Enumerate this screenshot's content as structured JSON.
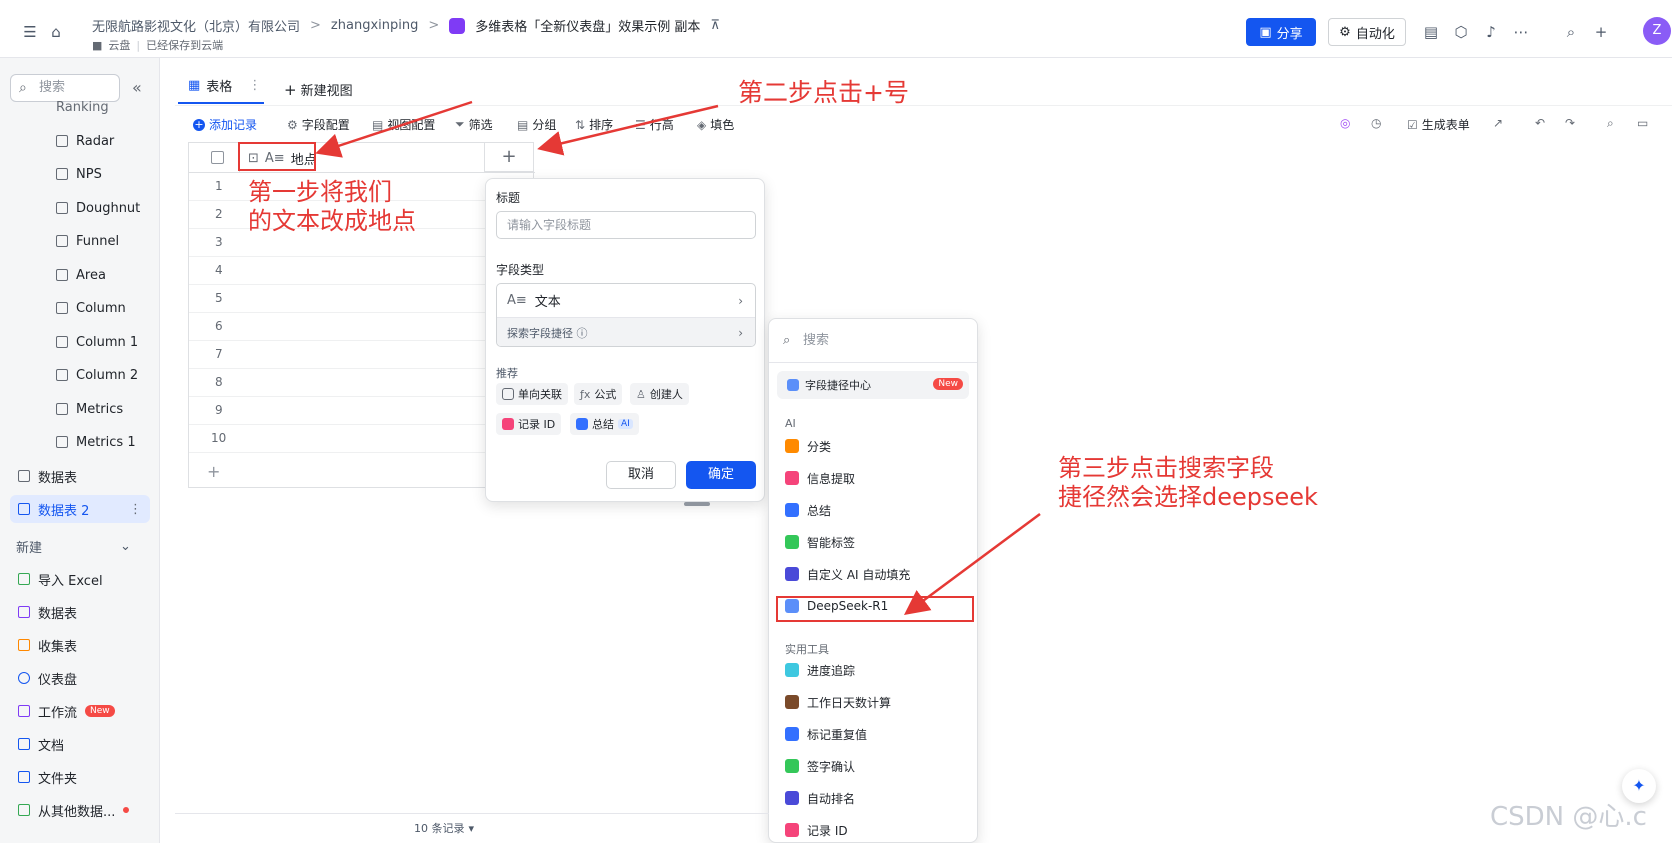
{
  "header": {
    "breadcrumb": [
      "无限航路影视文化（北京）有限公司",
      "zhangxinping"
    ],
    "doc_title": "多维表格「全新仪表盘」效果示例 副本",
    "pin_icon": "pin-icon",
    "location": "云盘",
    "save_status": "已经保存到云端",
    "share_label": "分享",
    "automation_label": "自动化",
    "avatar_letter": "Z"
  },
  "sidebar": {
    "search_placeholder": "搜索",
    "partial_item": "Ranking",
    "dashboards": [
      "Radar",
      "NPS",
      "Doughnut",
      "Funnel",
      "Area",
      "Column",
      "Column 1",
      "Column 2",
      "Metrics",
      "Metrics 1"
    ],
    "tables": [
      "数据表",
      "数据表 2"
    ],
    "new_label": "新建",
    "new_items": [
      "导入 Excel",
      "数据表",
      "收集表",
      "仪表盘",
      "工作流",
      "文档",
      "文件夹",
      "从其他数据..."
    ],
    "new_badge": "New"
  },
  "view": {
    "tab_label": "表格",
    "new_view_label": "新建视图"
  },
  "toolbar": {
    "add_record": "添加记录",
    "field_config": "字段配置",
    "view_config": "视图配置",
    "filter": "筛选",
    "group": "分组",
    "sort": "排序",
    "row_height": "行高",
    "fill_color": "填色",
    "generate_form": "生成表单"
  },
  "grid": {
    "column_header": "地点",
    "row_numbers": [
      "1",
      "2",
      "3",
      "4",
      "5",
      "6",
      "7",
      "8",
      "9",
      "10"
    ],
    "record_count": "10 条记录"
  },
  "field_panel": {
    "title_label": "标题",
    "title_placeholder": "请输入字段标题",
    "type_label": "字段类型",
    "type_value": "文本",
    "explore_label": "探索字段捷径 ⓘ",
    "recommend_label": "推荐",
    "chips": [
      "单向关联",
      "公式",
      "创建人",
      "记录 ID",
      "总结"
    ],
    "ai_tag": "AI",
    "cancel": "取消",
    "confirm": "确定"
  },
  "shortcut_menu": {
    "search_placeholder": "搜索",
    "center_label": "字段捷径中心",
    "center_badge": "New",
    "ai_section": "AI",
    "ai_items": [
      "分类",
      "信息提取",
      "总结",
      "智能标签",
      "自定义 AI 自动填充",
      "DeepSeek-R1"
    ],
    "tools_section": "实用工具",
    "tool_items": [
      "进度追踪",
      "工作日天数计算",
      "标记重复值",
      "签字确认",
      "自动排名",
      "记录 ID"
    ]
  },
  "annotations": {
    "step1_line1": "第一步将我们",
    "step1_line2": "的文本改成地点",
    "step2": "第二步点击+号",
    "step3_line1": "第三步点击搜索字段",
    "step3_line2": "捷径然会选择deepseek"
  },
  "watermark": "CSDN @心.c",
  "colors": {
    "accent": "#1456f0",
    "annotation_red": "#e53935",
    "sidebar_bg": "#f5f6f7"
  }
}
